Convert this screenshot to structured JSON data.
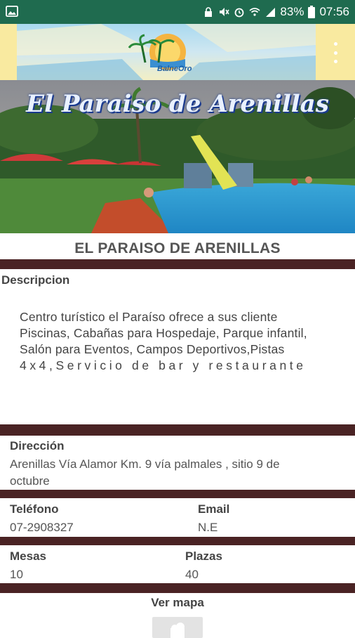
{
  "status_bar": {
    "battery": "83%",
    "time": "07:56"
  },
  "header": {
    "logo_text": "BalneOro"
  },
  "hero": {
    "overlay_title": "El Paraiso de Arenillas"
  },
  "page_title": "EL PARAISO DE ARENILLAS",
  "description": {
    "label": "Descripcion",
    "lines": [
      "Centro turístico el Paraíso ofrece a sus cliente",
      "Piscinas, Cabañas para Hospedaje, Parque infantil,",
      "Salón para Eventos, Campos Deportivos,Pistas",
      "4x4,Servicio de bar y restaurante"
    ]
  },
  "address": {
    "label": "Dirección",
    "value_line1": "Arenillas Vía Alamor Km. 9 vía palmales , sitio 9 de",
    "value_line2": "octubre"
  },
  "contact": {
    "phone_label": "Teléfono",
    "phone_value": "07-2908327",
    "email_label": "Email",
    "email_value": "N.E"
  },
  "capacity": {
    "tables_label": "Mesas",
    "tables_value": "10",
    "seats_label": "Plazas",
    "seats_value": "40"
  },
  "map": {
    "label": "Ver mapa"
  },
  "colors": {
    "status_bar": "#1f6b4f",
    "divider": "#4a2324",
    "header_bg": "#f9eaa0"
  }
}
